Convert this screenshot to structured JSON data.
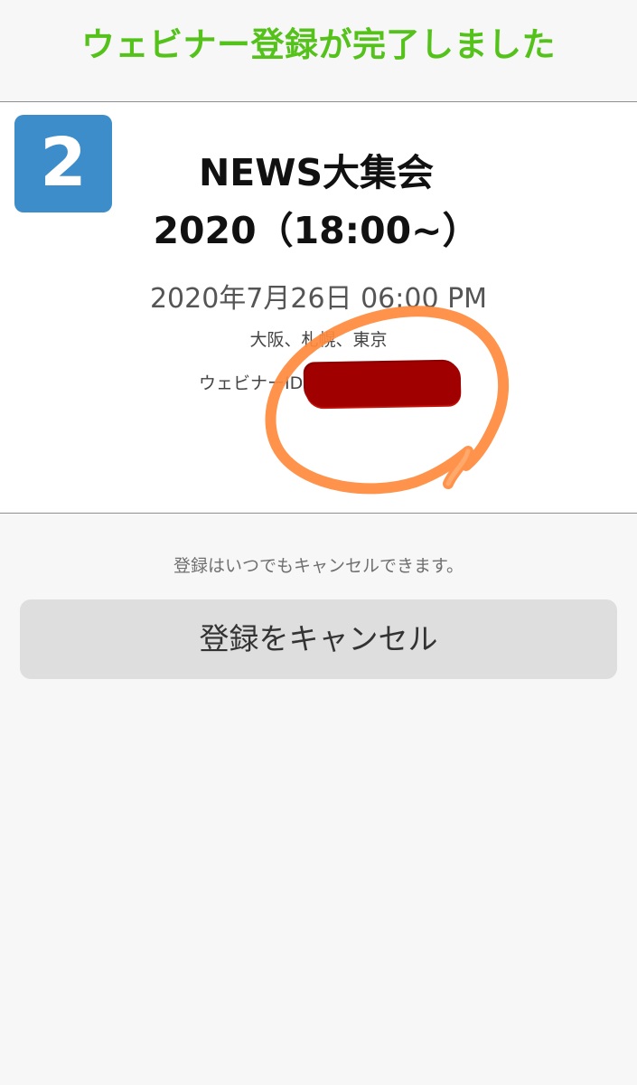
{
  "header": {
    "title": "ウェビナー登録が完了しました"
  },
  "event": {
    "step_number": "2",
    "title_line1": "NEWS大集会",
    "title_line2": "2020（18:00~）",
    "datetime": "2020年7月26日 06:00 PM",
    "location": "大阪、札幌、東京",
    "webinar_id_label": "ウェビナーID"
  },
  "footer": {
    "cancel_note": "登録はいつでもキャンセルできます。",
    "cancel_button_label": "登録をキャンセル"
  },
  "colors": {
    "accent_green": "#55c21b",
    "badge_blue": "#3c8dc9",
    "annotation_orange": "#ff8a3c",
    "redaction_red": "#a10000"
  }
}
